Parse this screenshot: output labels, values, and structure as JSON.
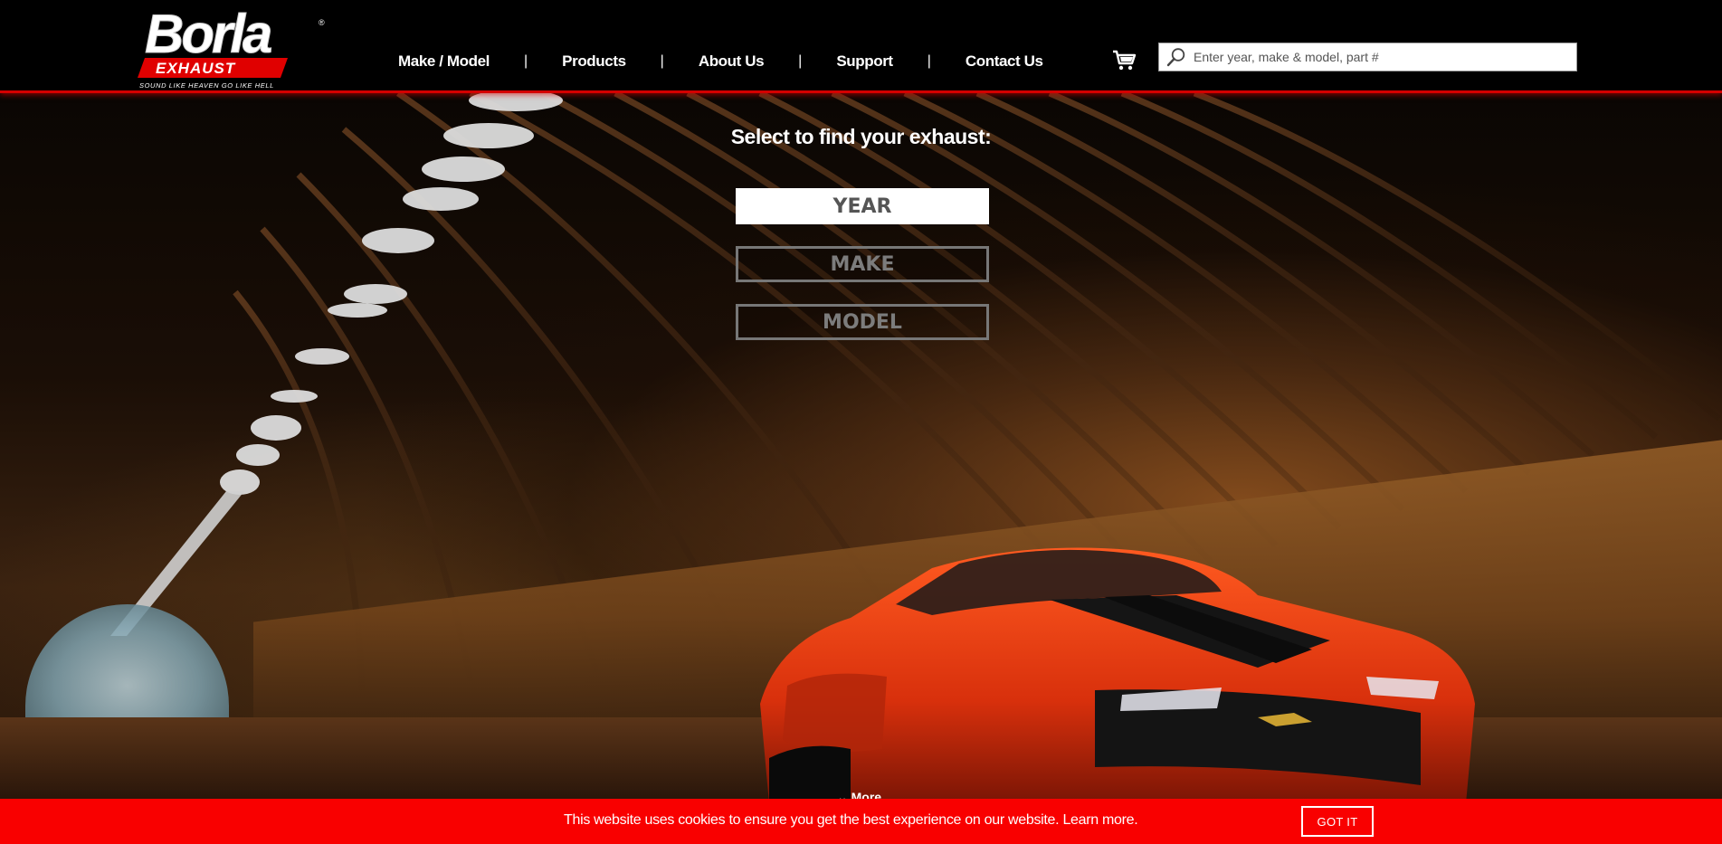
{
  "brand": {
    "logo_text": "Borla",
    "logo_sub": "EXHAUST",
    "tagline": "SOUND LIKE HEAVEN GO LIKE HELL",
    "registered": "®"
  },
  "nav": {
    "items": [
      {
        "label": "Make / Model"
      },
      {
        "label": "Products"
      },
      {
        "label": "About Us"
      },
      {
        "label": "Support"
      },
      {
        "label": "Contact Us"
      }
    ],
    "separator": "|"
  },
  "search": {
    "placeholder": "Enter year, make & model, part #",
    "value": ""
  },
  "finder": {
    "title": "Select to find your exhaust:",
    "year_label": "YEAR",
    "make_label": "MAKE",
    "model_label": "MODEL"
  },
  "hero": {
    "more_label": "More"
  },
  "cookie": {
    "message": "This website uses cookies to ensure you get the best experience on our website.",
    "learn_more": "Learn more.",
    "button": "GOT IT"
  },
  "icons": {
    "cart": "cart-icon",
    "search": "search-icon",
    "more": "chevron-down-icon"
  },
  "colors": {
    "accent_red": "#f90000",
    "header_border": "#d40000",
    "car_orange": "#e03a10"
  }
}
